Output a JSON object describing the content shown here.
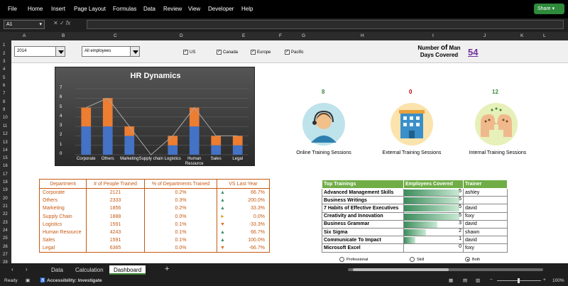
{
  "menu": [
    "File",
    "Home",
    "Insert",
    "Page Layout",
    "Formulas",
    "Data",
    "Review",
    "View",
    "Developer",
    "Help"
  ],
  "share_label": "Share",
  "name_box": "A1",
  "columns": [
    "A",
    "B",
    "C",
    "D",
    "E",
    "F",
    "G",
    "H",
    "I",
    "J",
    "K",
    "L"
  ],
  "rows": [
    "1",
    "2",
    "3",
    "4",
    "5",
    "6",
    "7",
    "8",
    "9",
    "10",
    "11",
    "12",
    "13",
    "14",
    "15",
    "16",
    "17",
    "18",
    "19",
    "20",
    "21",
    "22",
    "23",
    "24",
    "25",
    "26",
    "27",
    "28"
  ],
  "controls": {
    "year": "2014",
    "employees": "All employees",
    "regions": [
      "US",
      "Canada",
      "Europe",
      "Pacific"
    ],
    "checkmark": "✓"
  },
  "man_days": {
    "line1": "Number ",
    "of": "of",
    "line1b": " Man",
    "line2": "Days Covered",
    "value": "54"
  },
  "chart_data": {
    "type": "bar",
    "title": "HR Dynamics",
    "categories": [
      "Corporate",
      "Others",
      "Marketing",
      "Supply chain",
      "Logistics",
      "Human Resource",
      "Sales",
      "Legal"
    ],
    "series": [
      {
        "values": [
          3,
          3,
          2,
          0,
          1,
          3,
          1,
          1
        ]
      },
      {
        "values": [
          2,
          3,
          1,
          0,
          1,
          2,
          1,
          1
        ]
      }
    ],
    "line": [
      5,
      6,
      3,
      0,
      2,
      5,
      2,
      2
    ],
    "ylim": [
      0,
      7
    ],
    "yticks": [
      "0",
      "1",
      "2",
      "3",
      "4",
      "5",
      "6",
      "7"
    ],
    "colors": {
      "blue": "#4472c4",
      "orange": "#ed7d31",
      "line": "#a6a6a6"
    }
  },
  "trainings": [
    {
      "count": "8",
      "label": "Online Training Sessions",
      "color": "#3a8a3a"
    },
    {
      "count": "0",
      "label": "External Training Sessions",
      "color": "#c00000"
    },
    {
      "count": "12",
      "label": "Internal Training Sessions",
      "color": "#3a8a3a"
    }
  ],
  "dept_table": {
    "headers": [
      "Department",
      "# of People Trained",
      "% of Departments Trained",
      "VS Last Year"
    ],
    "rows": [
      {
        "dept": "Corporate",
        "people": "2121",
        "pct": "0.2%",
        "arrow": "up",
        "vs": "66.7%"
      },
      {
        "dept": "Others",
        "people": "2333",
        "pct": "0.3%",
        "arrow": "up",
        "vs": "200.0%"
      },
      {
        "dept": "Marketing",
        "people": "1856",
        "pct": "0.2%",
        "arrow": "up",
        "vs": "33.3%"
      },
      {
        "dept": "Supply Chain",
        "people": "1888",
        "pct": "0.0%",
        "arrow": "side",
        "vs": "0.0%"
      },
      {
        "dept": "Logistics",
        "people": "1591",
        "pct": "0.1%",
        "arrow": "down",
        "vs": "-33.3%"
      },
      {
        "dept": "Human Resource",
        "people": "4243",
        "pct": "0.1%",
        "arrow": "up",
        "vs": "66.7%"
      },
      {
        "dept": "Sales",
        "people": "1591",
        "pct": "0.1%",
        "arrow": "up",
        "vs": "100.0%"
      },
      {
        "dept": "Legal",
        "people": "6365",
        "pct": "0.0%",
        "arrow": "down",
        "vs": "-66.7%"
      }
    ]
  },
  "top_trainings": {
    "headers": [
      "Top Trainings",
      "Employees Covered",
      "Trainer"
    ],
    "rows": [
      {
        "name": "Advanced Management Skills",
        "covered": 5,
        "trainer": "ashley"
      },
      {
        "name": "Business Writings",
        "covered": 5,
        "trainer": ""
      },
      {
        "name": "7 Habits of Effective Executives",
        "covered": 5,
        "trainer": "david"
      },
      {
        "name": "Creativity and Innovation",
        "covered": 5,
        "trainer": "foxy"
      },
      {
        "name": "Business Grammar",
        "covered": 3,
        "trainer": "david"
      },
      {
        "name": "Six Sigma",
        "covered": 2,
        "trainer": "shawn"
      },
      {
        "name": "Communicate To Impact",
        "covered": 1,
        "trainer": "david"
      },
      {
        "name": "Microsoft Excel",
        "covered": 0,
        "trainer": "foxy"
      }
    ],
    "max": 5
  },
  "radios": [
    {
      "label": "Professional",
      "on": false
    },
    {
      "label": "Skill",
      "on": false
    },
    {
      "label": "Both",
      "on": true
    }
  ],
  "sheet_tabs": [
    "Data",
    "Calculation",
    "Dashboard"
  ],
  "active_tab": "Dashboard",
  "status": {
    "ready": "Ready",
    "accessibility": "Accessibility: Investigate",
    "zoom": "100%"
  }
}
